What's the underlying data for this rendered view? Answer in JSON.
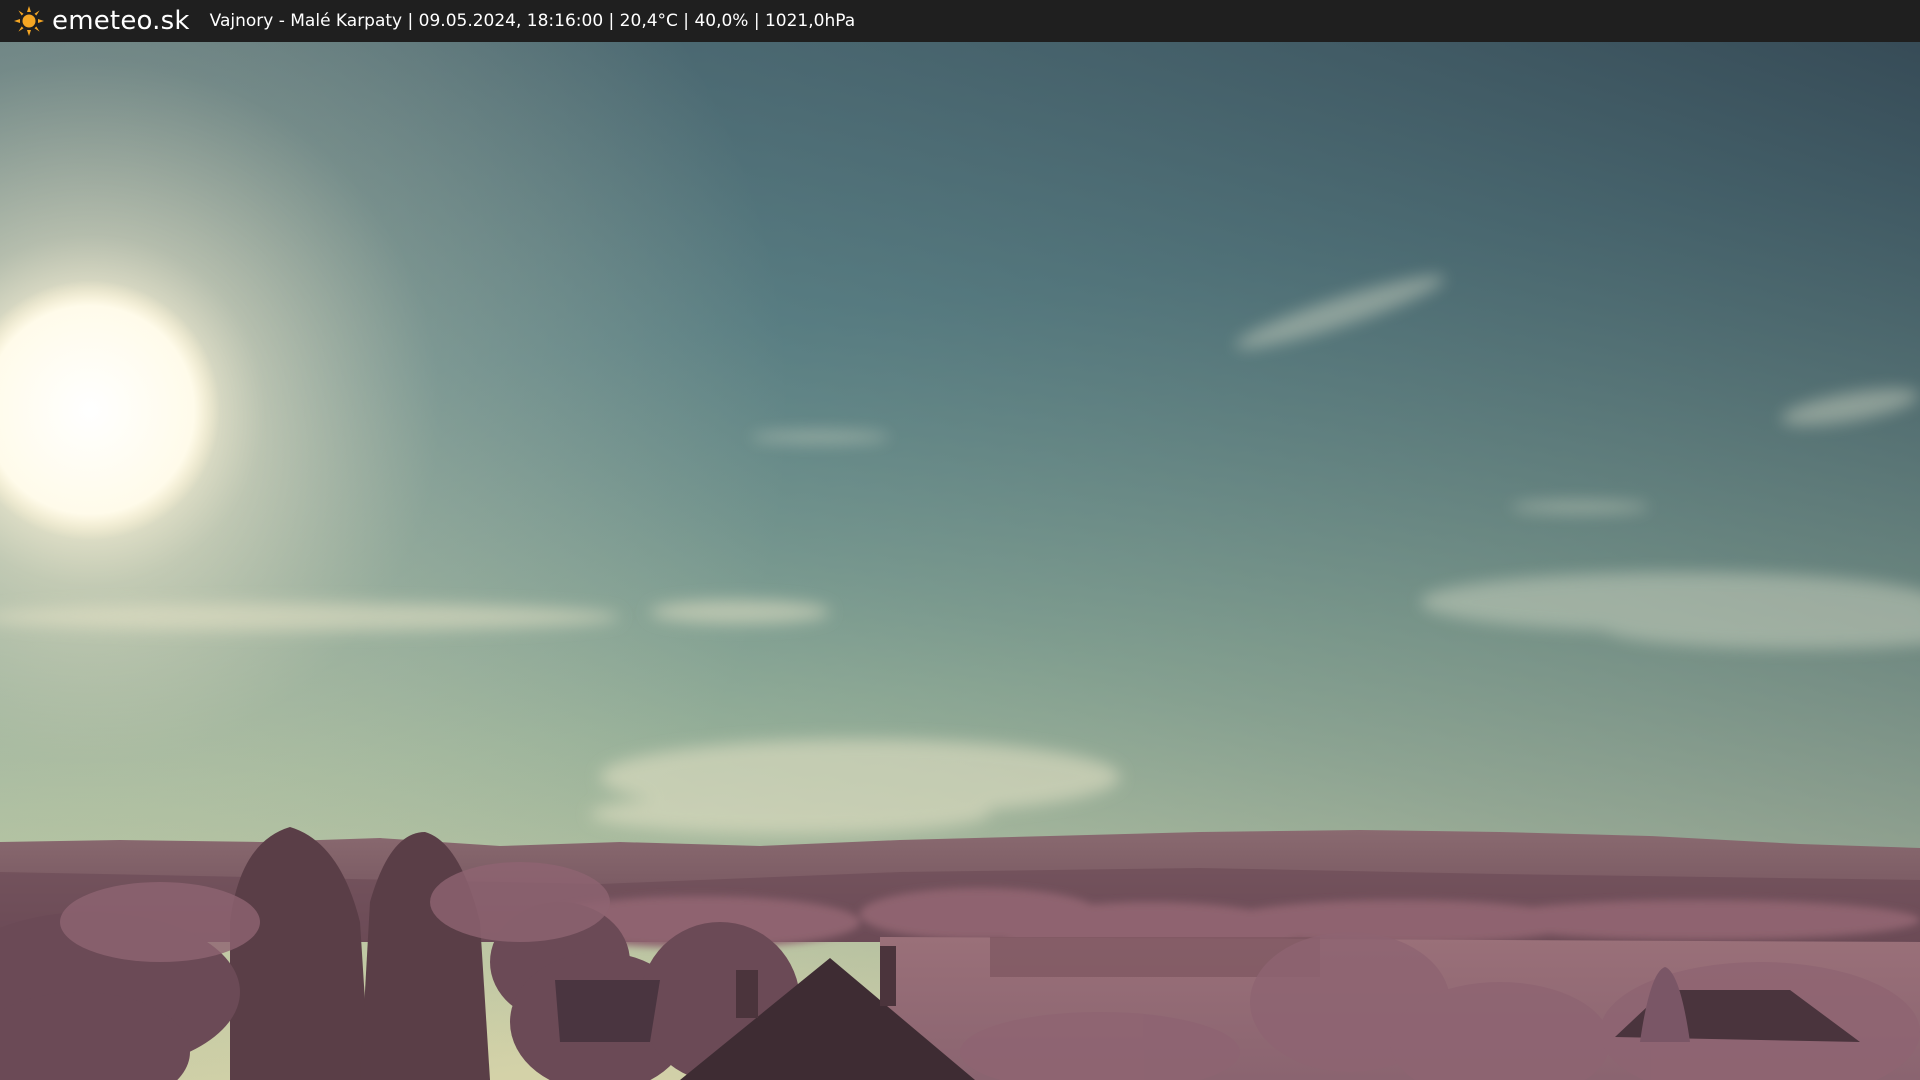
{
  "header": {
    "brand": "emeteo.sk",
    "caption": "Vajnory - Malé Karpaty | 09.05.2024, 18:16:00 | 20,4°C | 40,0% | 1021,0hPa",
    "logo_icon": "sun-icon",
    "background_color": "#1f1f1f",
    "logo_color": "#f5a623"
  },
  "scene": {
    "description_icon": "webcam-landscape-image",
    "sky_top_color": "#3d5563",
    "sky_mid_color": "#6f9a9a",
    "sky_horizon_color": "#c9cfa8",
    "hills_color": "#7a5560",
    "foliage_color": "#9b6b78"
  }
}
